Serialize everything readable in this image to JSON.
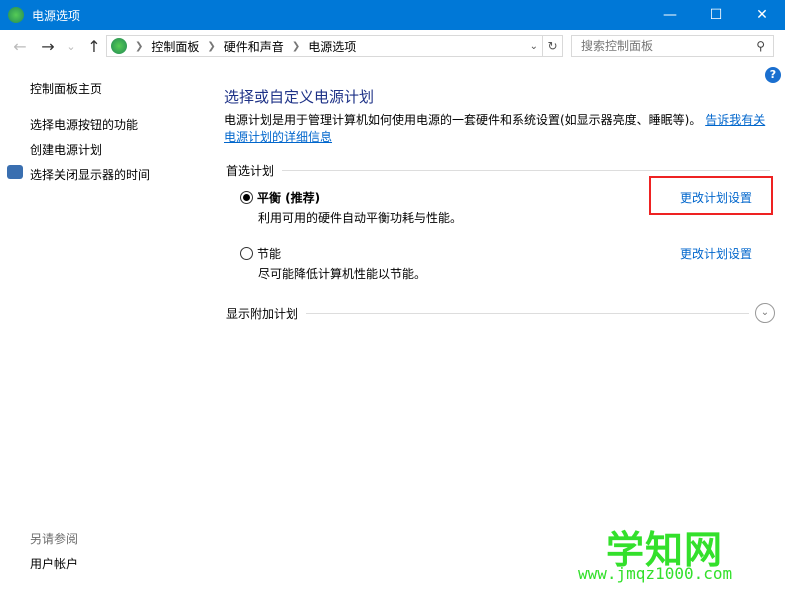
{
  "window": {
    "title": "电源选项",
    "minimize": "—",
    "maximize": "☐",
    "close": "✕"
  },
  "nav": {
    "back": "←",
    "forward": "→",
    "recent": "⌄",
    "up": "↑",
    "breadcrumb": [
      "控制面板",
      "硬件和声音",
      "电源选项"
    ],
    "refresh": "↻",
    "dropdown": "⌄"
  },
  "search": {
    "placeholder": "搜索控制面板",
    "icon": "⚲"
  },
  "help": "?",
  "sidebar": {
    "items": [
      "控制面板主页",
      "选择电源按钮的功能",
      "创建电源计划",
      "选择关闭显示器的时间"
    ],
    "see_also": "另请参阅",
    "see_also_items": [
      "用户帐户"
    ]
  },
  "main": {
    "title": "选择或自定义电源计划",
    "description": "电源计划是用于管理计算机如何使用电源的一套硬件和系统设置(如显示器亮度、睡眠等)。",
    "learn_more": "告诉我有关电源计划的详细信息",
    "preferred_label": "首选计划",
    "plans": [
      {
        "name": "平衡 (推荐)",
        "description": "利用可用的硬件自动平衡功耗与性能。",
        "selected": true,
        "link": "更改计划设置"
      },
      {
        "name": "节能",
        "description": "尽可能降低计算机性能以节能。",
        "selected": false,
        "link": "更改计划设置"
      }
    ],
    "show_additional": "显示附加计划",
    "expand_icon": "⌄"
  },
  "watermark": {
    "title": "学知网",
    "url": "www.jmqz1000.com"
  },
  "colors": {
    "titlebar": "#0078d7",
    "link": "#0066cc",
    "heading": "#1e3287",
    "highlight": "#ee2222"
  }
}
